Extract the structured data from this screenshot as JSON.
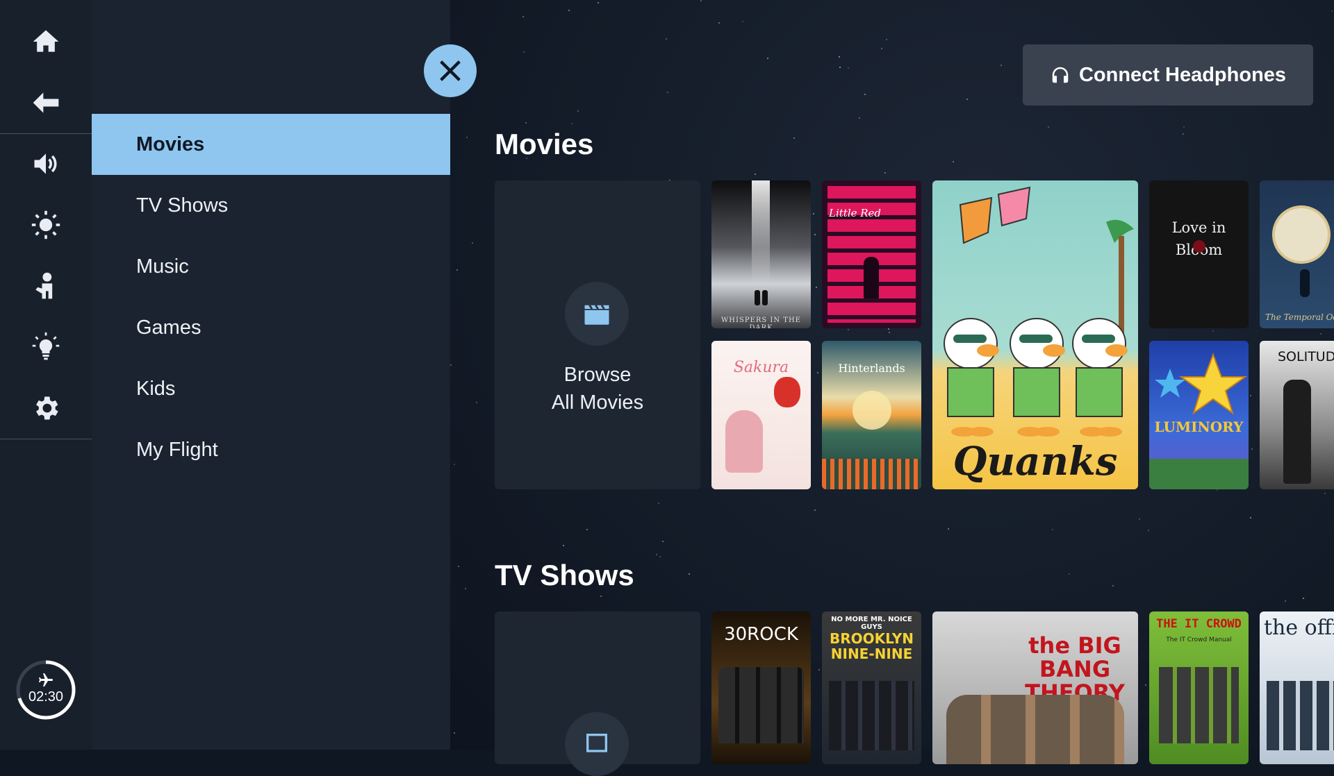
{
  "sidebar": {
    "clock_time": "02:30"
  },
  "nav": {
    "items": [
      {
        "label": "Movies",
        "active": true
      },
      {
        "label": "TV Shows",
        "active": false
      },
      {
        "label": "Music",
        "active": false
      },
      {
        "label": "Games",
        "active": false
      },
      {
        "label": "Kids",
        "active": false
      },
      {
        "label": "My Flight",
        "active": false
      }
    ]
  },
  "header": {
    "connect_label": "Connect Headphones"
  },
  "movies": {
    "title": "Movies",
    "browse_line1": "Browse",
    "browse_line2": "All Movies",
    "posters": [
      {
        "title": "WHISPERS IN THE DARK"
      },
      {
        "title": "Little Red"
      },
      {
        "title": "Quanks"
      },
      {
        "title": "Love in Bloom"
      },
      {
        "title": "The Temporal Odyssey"
      },
      {
        "title": "Sakura"
      },
      {
        "title": "Hinterlands"
      },
      {
        "title": "LUMINORY"
      },
      {
        "title": "SOLITUD"
      }
    ]
  },
  "tv": {
    "title": "TV Shows",
    "posters": [
      {
        "title": "30ROCK"
      },
      {
        "title": "BROOKLYN NINE-NINE",
        "tagline": "NO MORE MR. NOICE GUYS"
      },
      {
        "title": "the BIG BANG THEORY"
      },
      {
        "title": "THE IT CROWD",
        "subtitle": "The IT Crowd Manual"
      },
      {
        "title": "the offic"
      }
    ]
  },
  "colors": {
    "accent": "#8ec6ef",
    "panel": "#1b2330",
    "rail": "#18202c"
  }
}
